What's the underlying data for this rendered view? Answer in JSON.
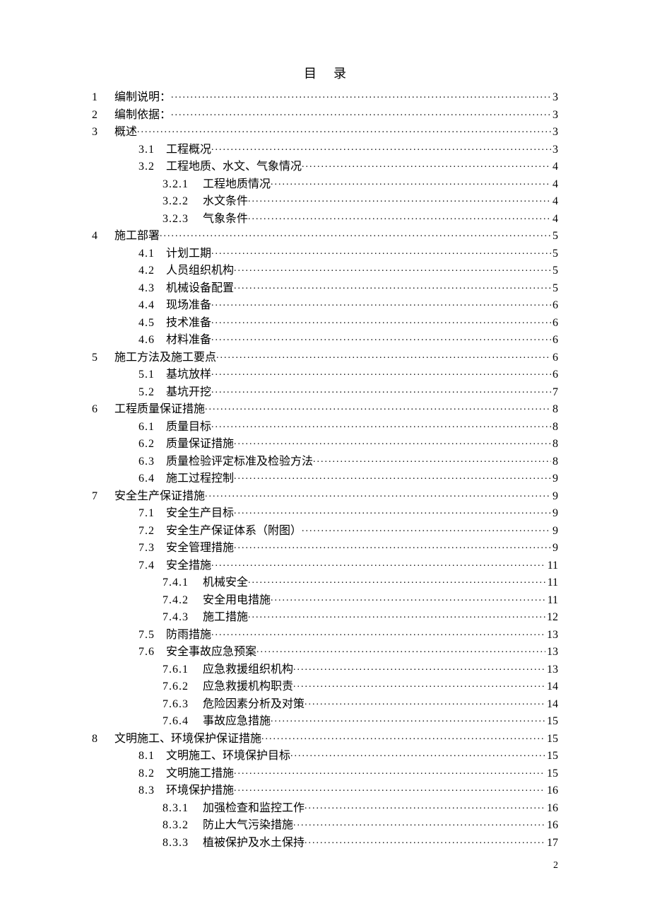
{
  "title": "目录",
  "page_number": "2",
  "entries": [
    {
      "level": 1,
      "chap": "1",
      "num": "",
      "text": "编制说明：",
      "page": "3"
    },
    {
      "level": 1,
      "chap": "2",
      "num": "",
      "text": "编制依据：",
      "page": "3"
    },
    {
      "level": 1,
      "chap": "3",
      "num": "",
      "text": "概述",
      "page": "3"
    },
    {
      "level": 2,
      "chap": "",
      "num": "3.1",
      "text": "工程概况",
      "page": "3"
    },
    {
      "level": 2,
      "chap": "",
      "num": "3.2",
      "text": "工程地质、水文、气象情况",
      "page": "4"
    },
    {
      "level": 3,
      "chap": "",
      "num": "3.2.1",
      "text": "工程地质情况",
      "page": "4"
    },
    {
      "level": 3,
      "chap": "",
      "num": "3.2.2",
      "text": "水文条件",
      "page": "4"
    },
    {
      "level": 3,
      "chap": "",
      "num": "3.2.3",
      "text": "气象条件",
      "page": "4"
    },
    {
      "level": 1,
      "chap": "4",
      "num": "",
      "text": "施工部署",
      "page": "5"
    },
    {
      "level": 2,
      "chap": "",
      "num": "4.1",
      "text": "计划工期",
      "page": "5"
    },
    {
      "level": 2,
      "chap": "",
      "num": "4.2",
      "text": "人员组织机构",
      "page": "5"
    },
    {
      "level": 2,
      "chap": "",
      "num": "4.3",
      "text": "机械设备配置",
      "page": "5"
    },
    {
      "level": 2,
      "chap": "",
      "num": "4.4",
      "text": "现场准备",
      "page": "6"
    },
    {
      "level": 2,
      "chap": "",
      "num": "4.5",
      "text": "技术准备",
      "page": "6"
    },
    {
      "level": 2,
      "chap": "",
      "num": "4.6",
      "text": "材料准备",
      "page": "6"
    },
    {
      "level": 1,
      "chap": "5",
      "num": "",
      "text": "施工方法及施工要点",
      "page": "6"
    },
    {
      "level": 2,
      "chap": "",
      "num": "5.1",
      "text": "基坑放样",
      "page": "6"
    },
    {
      "level": 2,
      "chap": "",
      "num": "5.2",
      "text": "基坑开挖",
      "page": "7"
    },
    {
      "level": 1,
      "chap": "6",
      "num": "",
      "text": "工程质量保证措施",
      "page": "8"
    },
    {
      "level": 2,
      "chap": "",
      "num": "6.1",
      "text": "质量目标",
      "page": "8"
    },
    {
      "level": 2,
      "chap": "",
      "num": "6.2",
      "text": "质量保证措施",
      "page": "8"
    },
    {
      "level": 2,
      "chap": "",
      "num": "6.3",
      "text": "质量检验评定标准及检验方法",
      "page": "8"
    },
    {
      "level": 2,
      "chap": "",
      "num": "6.4",
      "text": "施工过程控制",
      "page": "9"
    },
    {
      "level": 1,
      "chap": "7",
      "num": "",
      "text": "安全生产保证措施",
      "page": "9"
    },
    {
      "level": 2,
      "chap": "",
      "num": "7.1",
      "text": "安全生产目标",
      "page": "9"
    },
    {
      "level": 2,
      "chap": "",
      "num": "7.2",
      "text": "安全生产保证体系（附图）",
      "page": "9"
    },
    {
      "level": 2,
      "chap": "",
      "num": "7.3",
      "text": "安全管理措施",
      "page": "9"
    },
    {
      "level": 2,
      "chap": "",
      "num": "7.4",
      "text": "安全措施",
      "page": "11"
    },
    {
      "level": 3,
      "chap": "",
      "num": "7.4.1",
      "text": "机械安全",
      "page": "11"
    },
    {
      "level": 3,
      "chap": "",
      "num": "7.4.2",
      "text": "安全用电措施",
      "page": "11"
    },
    {
      "level": 3,
      "chap": "",
      "num": "7.4.3",
      "text": "施工措施",
      "page": "12"
    },
    {
      "level": 2,
      "chap": "",
      "num": "7.5",
      "text": "防雨措施",
      "page": "13"
    },
    {
      "level": 2,
      "chap": "",
      "num": "7.6",
      "text": "安全事故应急预案",
      "page": "13"
    },
    {
      "level": 3,
      "chap": "",
      "num": "7.6.1",
      "text": "应急救援组织机构",
      "page": "13"
    },
    {
      "level": 3,
      "chap": "",
      "num": "7.6.2",
      "text": "应急救援机构职责",
      "page": "14"
    },
    {
      "level": 3,
      "chap": "",
      "num": "7.6.3",
      "text": "危险因素分析及对策",
      "page": "14"
    },
    {
      "level": 3,
      "chap": "",
      "num": "7.6.4",
      "text": "事故应急措施",
      "page": "15"
    },
    {
      "level": 1,
      "chap": "8",
      "num": "",
      "text": "文明施工、环境保护保证措施",
      "page": "15"
    },
    {
      "level": 2,
      "chap": "",
      "num": "8.1",
      "text": "文明施工、环境保护目标",
      "page": "15"
    },
    {
      "level": 2,
      "chap": "",
      "num": "8.2",
      "text": "文明施工措施",
      "page": "15"
    },
    {
      "level": 2,
      "chap": "",
      "num": "8.3",
      "text": "环境保护措施",
      "page": "16"
    },
    {
      "level": 3,
      "chap": "",
      "num": "8.3.1",
      "text": "加强检查和监控工作",
      "page": "16"
    },
    {
      "level": 3,
      "chap": "",
      "num": "8.3.2",
      "text": "防止大气污染措施",
      "page": "16"
    },
    {
      "level": 3,
      "chap": "",
      "num": "8.3.3",
      "text": "植被保护及水土保持",
      "page": "17"
    }
  ]
}
